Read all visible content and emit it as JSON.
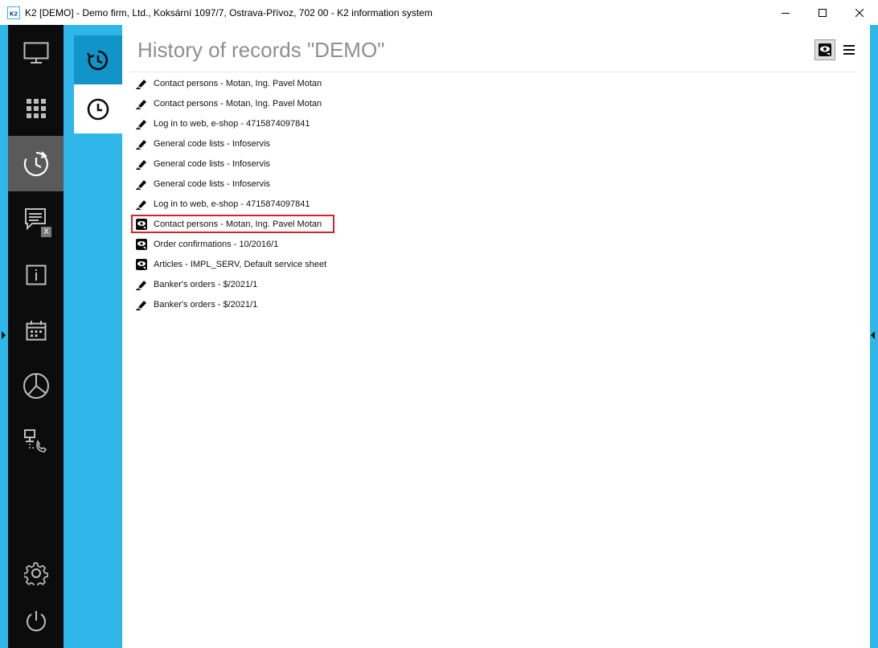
{
  "window": {
    "title": "K2 [DEMO] - Demo firm, Ltd., Koksární 1097/7, Ostrava-Přívoz, 702 00 - K2 information system",
    "app_icon_text": "K2"
  },
  "rail": {
    "items": [
      {
        "icon": "monitor-icon"
      },
      {
        "icon": "apps-grid-icon"
      },
      {
        "icon": "history-clock-icon",
        "active": true
      },
      {
        "icon": "messages-icon",
        "badge": "X"
      },
      {
        "icon": "info-icon"
      },
      {
        "icon": "calendar-icon"
      },
      {
        "icon": "pie-chart-icon"
      },
      {
        "icon": "network-phone-icon"
      },
      {
        "icon": "settings-gear-icon"
      },
      {
        "icon": "power-icon"
      }
    ]
  },
  "subnav": {
    "tabs": [
      {
        "icon": "history-icon",
        "selected": false
      },
      {
        "icon": "clock-icon",
        "selected": true
      }
    ]
  },
  "main": {
    "title": "History of records \"DEMO\"",
    "records": [
      {
        "icon": "edit-pen-icon",
        "text": "Contact persons - Motan, Ing. Pavel Motan"
      },
      {
        "icon": "edit-pen-icon",
        "text": "Contact persons - Motan, Ing. Pavel Motan"
      },
      {
        "icon": "edit-pen-icon",
        "text": "Log in to web, e-shop - 4715874097841"
      },
      {
        "icon": "edit-pen-icon",
        "text": "General code lists - Infoservis"
      },
      {
        "icon": "edit-pen-icon",
        "text": "General code lists - Infoservis"
      },
      {
        "icon": "edit-pen-icon",
        "text": "General code lists - Infoservis"
      },
      {
        "icon": "edit-pen-icon",
        "text": "Log in to web, e-shop - 4715874097841"
      },
      {
        "icon": "view-eye-icon",
        "text": "Contact persons - Motan, Ing. Pavel Motan",
        "highlighted": true
      },
      {
        "icon": "view-eye-icon",
        "text": "Order confirmations - 10/2016/1"
      },
      {
        "icon": "view-eye-icon",
        "text": "Articles - IMPL_SERV, Default service sheet"
      },
      {
        "icon": "edit-pen-icon",
        "text": "Banker's orders - $/2021/1"
      },
      {
        "icon": "edit-pen-icon",
        "text": "Banker's orders - $/2021/1"
      }
    ]
  },
  "colors": {
    "frame": "#2fb7ea",
    "rail": "#0c0c0c",
    "rail_active": "#5a5a5a",
    "subtab_active": "#1194c7",
    "title_text": "#8f8f8f",
    "highlight_border": "#d4242b"
  }
}
